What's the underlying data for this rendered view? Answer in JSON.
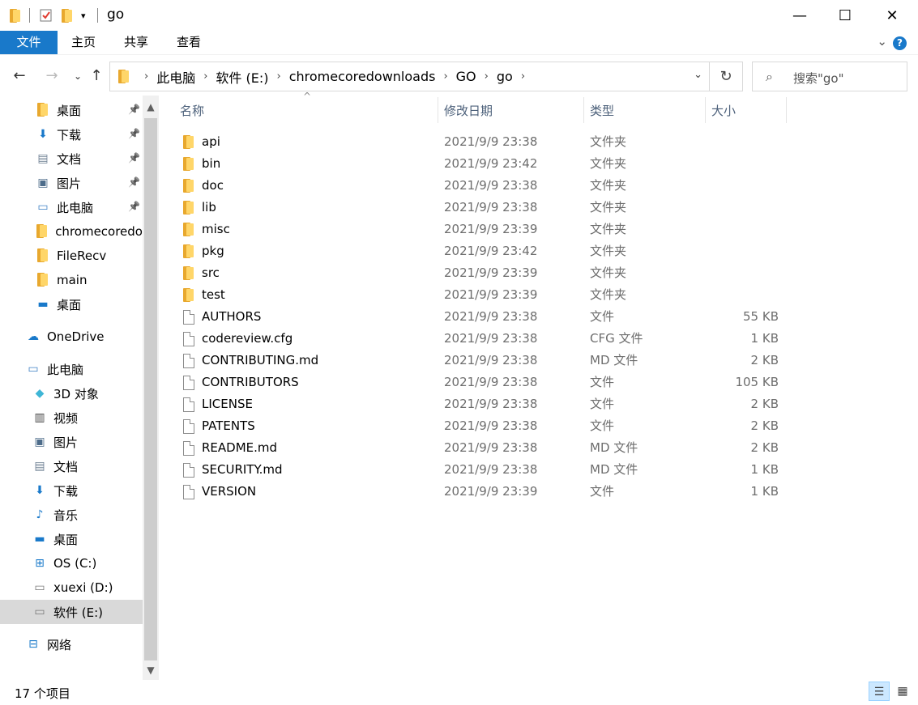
{
  "window": {
    "title": "go",
    "minimize": "—",
    "maximize": "☐",
    "close": "✕"
  },
  "ribbon": {
    "tabs": [
      "文件",
      "主页",
      "共享",
      "查看"
    ],
    "help": "?"
  },
  "address": {
    "crumbs": [
      "此电脑",
      "软件 (E:)",
      "chromecoredownloads",
      "GO",
      "go"
    ]
  },
  "search": {
    "placeholder": "搜索\"go\""
  },
  "columns": {
    "name": "名称",
    "date": "修改日期",
    "type": "类型",
    "size": "大小"
  },
  "sidebar": {
    "items": [
      {
        "label": "桌面",
        "icon": "folder-icon",
        "pinned": true
      },
      {
        "label": "下载",
        "icon": "download-icon",
        "pinned": true
      },
      {
        "label": "文档",
        "icon": "document-icon",
        "pinned": true
      },
      {
        "label": "图片",
        "icon": "picture-icon",
        "pinned": true
      },
      {
        "label": "此电脑",
        "icon": "computer-icon",
        "pinned": true
      },
      {
        "label": "chromecoredo",
        "icon": "folder-icon",
        "pinned": false
      },
      {
        "label": "FileRecv",
        "icon": "folder-icon",
        "pinned": false
      },
      {
        "label": "main",
        "icon": "folder-icon",
        "pinned": false
      },
      {
        "label": "桌面",
        "icon": "desktop-icon",
        "pinned": false
      },
      {
        "label": "OneDrive",
        "icon": "cloud-icon",
        "pinned": false
      },
      {
        "label": "此电脑",
        "icon": "computer-icon",
        "pinned": false
      },
      {
        "label": "3D 对象",
        "icon": "3d-objects-icon",
        "pinned": false
      },
      {
        "label": "视频",
        "icon": "video-icon",
        "pinned": false
      },
      {
        "label": "图片",
        "icon": "picture-icon",
        "pinned": false
      },
      {
        "label": "文档",
        "icon": "document-icon",
        "pinned": false
      },
      {
        "label": "下载",
        "icon": "download-icon",
        "pinned": false
      },
      {
        "label": "音乐",
        "icon": "music-icon",
        "pinned": false
      },
      {
        "label": "桌面",
        "icon": "desktop-icon",
        "pinned": false
      },
      {
        "label": "OS (C:)",
        "icon": "windows-drive-icon",
        "pinned": false
      },
      {
        "label": "xuexi (D:)",
        "icon": "drive-icon",
        "pinned": false
      },
      {
        "label": "软件 (E:)",
        "icon": "drive-icon",
        "pinned": false,
        "selected": true
      },
      {
        "label": "网络",
        "icon": "network-icon",
        "pinned": false
      }
    ]
  },
  "files": [
    {
      "name": "api",
      "date": "2021/9/9 23:38",
      "type": "文件夹",
      "size": "",
      "kind": "folder"
    },
    {
      "name": "bin",
      "date": "2021/9/9 23:42",
      "type": "文件夹",
      "size": "",
      "kind": "folder"
    },
    {
      "name": "doc",
      "date": "2021/9/9 23:38",
      "type": "文件夹",
      "size": "",
      "kind": "folder"
    },
    {
      "name": "lib",
      "date": "2021/9/9 23:38",
      "type": "文件夹",
      "size": "",
      "kind": "folder"
    },
    {
      "name": "misc",
      "date": "2021/9/9 23:39",
      "type": "文件夹",
      "size": "",
      "kind": "folder"
    },
    {
      "name": "pkg",
      "date": "2021/9/9 23:42",
      "type": "文件夹",
      "size": "",
      "kind": "folder"
    },
    {
      "name": "src",
      "date": "2021/9/9 23:39",
      "type": "文件夹",
      "size": "",
      "kind": "folder"
    },
    {
      "name": "test",
      "date": "2021/9/9 23:39",
      "type": "文件夹",
      "size": "",
      "kind": "folder"
    },
    {
      "name": "AUTHORS",
      "date": "2021/9/9 23:38",
      "type": "文件",
      "size": "55 KB",
      "kind": "file"
    },
    {
      "name": "codereview.cfg",
      "date": "2021/9/9 23:38",
      "type": "CFG 文件",
      "size": "1 KB",
      "kind": "file"
    },
    {
      "name": "CONTRIBUTING.md",
      "date": "2021/9/9 23:38",
      "type": "MD 文件",
      "size": "2 KB",
      "kind": "file"
    },
    {
      "name": "CONTRIBUTORS",
      "date": "2021/9/9 23:38",
      "type": "文件",
      "size": "105 KB",
      "kind": "file"
    },
    {
      "name": "LICENSE",
      "date": "2021/9/9 23:38",
      "type": "文件",
      "size": "2 KB",
      "kind": "file"
    },
    {
      "name": "PATENTS",
      "date": "2021/9/9 23:38",
      "type": "文件",
      "size": "2 KB",
      "kind": "file"
    },
    {
      "name": "README.md",
      "date": "2021/9/9 23:38",
      "type": "MD 文件",
      "size": "2 KB",
      "kind": "file"
    },
    {
      "name": "SECURITY.md",
      "date": "2021/9/9 23:38",
      "type": "MD 文件",
      "size": "1 KB",
      "kind": "file"
    },
    {
      "name": "VERSION",
      "date": "2021/9/9 23:39",
      "type": "文件",
      "size": "1 KB",
      "kind": "file"
    }
  ],
  "status": {
    "count": "17 个项目"
  },
  "colors": {
    "accent": "#1979ca",
    "folder": "#ffd669",
    "selected": "#d9d9d9"
  }
}
